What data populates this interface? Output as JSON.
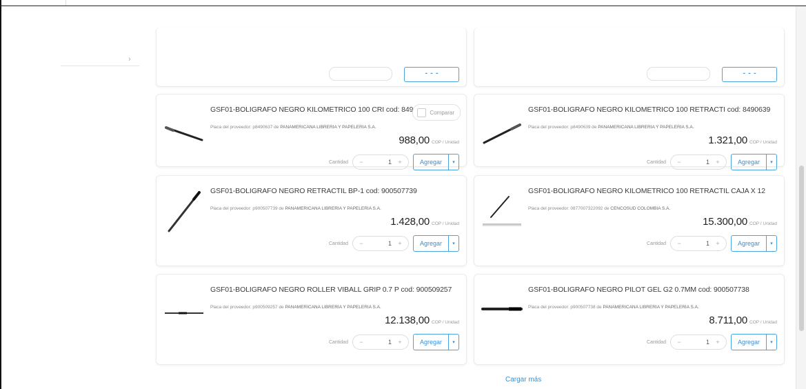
{
  "products": [
    {
      "title": "GSF01-BOLIGRAFO NEGRO KILOMETRICO 100 CRI cod: 8490637",
      "supplier_prefix": "Placa del proveedor: p8490637 de",
      "supplier_name": "PANAMERICANA LIBRERÍA Y PAPELERÍA S.A.",
      "price": "988,00",
      "unit": "COP / Unidad",
      "qty_label": "Cantidad",
      "qty": "1",
      "add_label": "Agregar",
      "compare_label": "Comparar",
      "pen": "diagonal-down"
    },
    {
      "title": "GSF01-BOLIGRAFO NEGRO KILOMETRICO 100 RETRACTI cod: 8490639",
      "supplier_prefix": "Placa del proveedor: p8490639 de",
      "supplier_name": "PANAMERICANA LIBRERÍA Y PAPELERÍA S.A.",
      "price": "1.321,00",
      "unit": "COP / Unidad",
      "qty_label": "Cantidad",
      "qty": "1",
      "add_label": "Agregar",
      "pen": "diagonal-up"
    },
    {
      "title": "GSF01-BOLIGRAFO NEGRO RETRACTIL BP-1 cod: 900507739",
      "supplier_prefix": "Placa del proveedor: p900507739 de",
      "supplier_name": "PANAMERICANA LIBRERÍA Y PAPELERÍA S.A.",
      "price": "1.428,00",
      "unit": "COP / Unidad",
      "qty_label": "Cantidad",
      "qty": "1",
      "add_label": "Agregar",
      "pen": "steep-up"
    },
    {
      "title": "GSF01-BOLIGRAFO NEGRO KILOMETRICO 100 RETRACTIL CAJA X 12",
      "supplier_prefix": "Placa del proveedor: 0877007322092 de",
      "supplier_name": "CENCOSUD COLOMBIA S.A.",
      "price": "15.300,00",
      "unit": "COP / Unidad",
      "qty_label": "Cantidad",
      "qty": "1",
      "add_label": "Agregar",
      "pen": "box"
    },
    {
      "title": "GSF01-BOLIGRAFO NEGRO ROLLER VIBALL GRIP 0.7 P cod: 900509257",
      "supplier_prefix": "Placa del proveedor: p900509257 de",
      "supplier_name": "PANAMERICANA LIBRERÍA Y PAPELERÍA S.A.",
      "price": "12.138,00",
      "unit": "COP / Unidad",
      "qty_label": "Cantidad",
      "qty": "1",
      "add_label": "Agregar",
      "pen": "horizontal"
    },
    {
      "title": "GSF01-BOLIGRAFO NEGRO PILOT GEL G2 0.7MM cod: 900507738",
      "supplier_prefix": "Placa del proveedor: p900507738 de",
      "supplier_name": "PANAMERICANA LIBRERÍA Y PAPELERÍA S.A.",
      "price": "8.711,00",
      "unit": "COP / Unidad",
      "qty_label": "Cantidad",
      "qty": "1",
      "add_label": "Agregar",
      "pen": "horizontal-thick"
    }
  ],
  "load_more_label": "Cargar más",
  "colors": {
    "accent": "#3b8fd0",
    "border": "#e9ecef",
    "text": "#333333"
  },
  "icons": [
    "chevron-right-icon",
    "checkbox-icon",
    "chevron-down-icon",
    "minus-icon",
    "plus-icon",
    "pen-image"
  ]
}
